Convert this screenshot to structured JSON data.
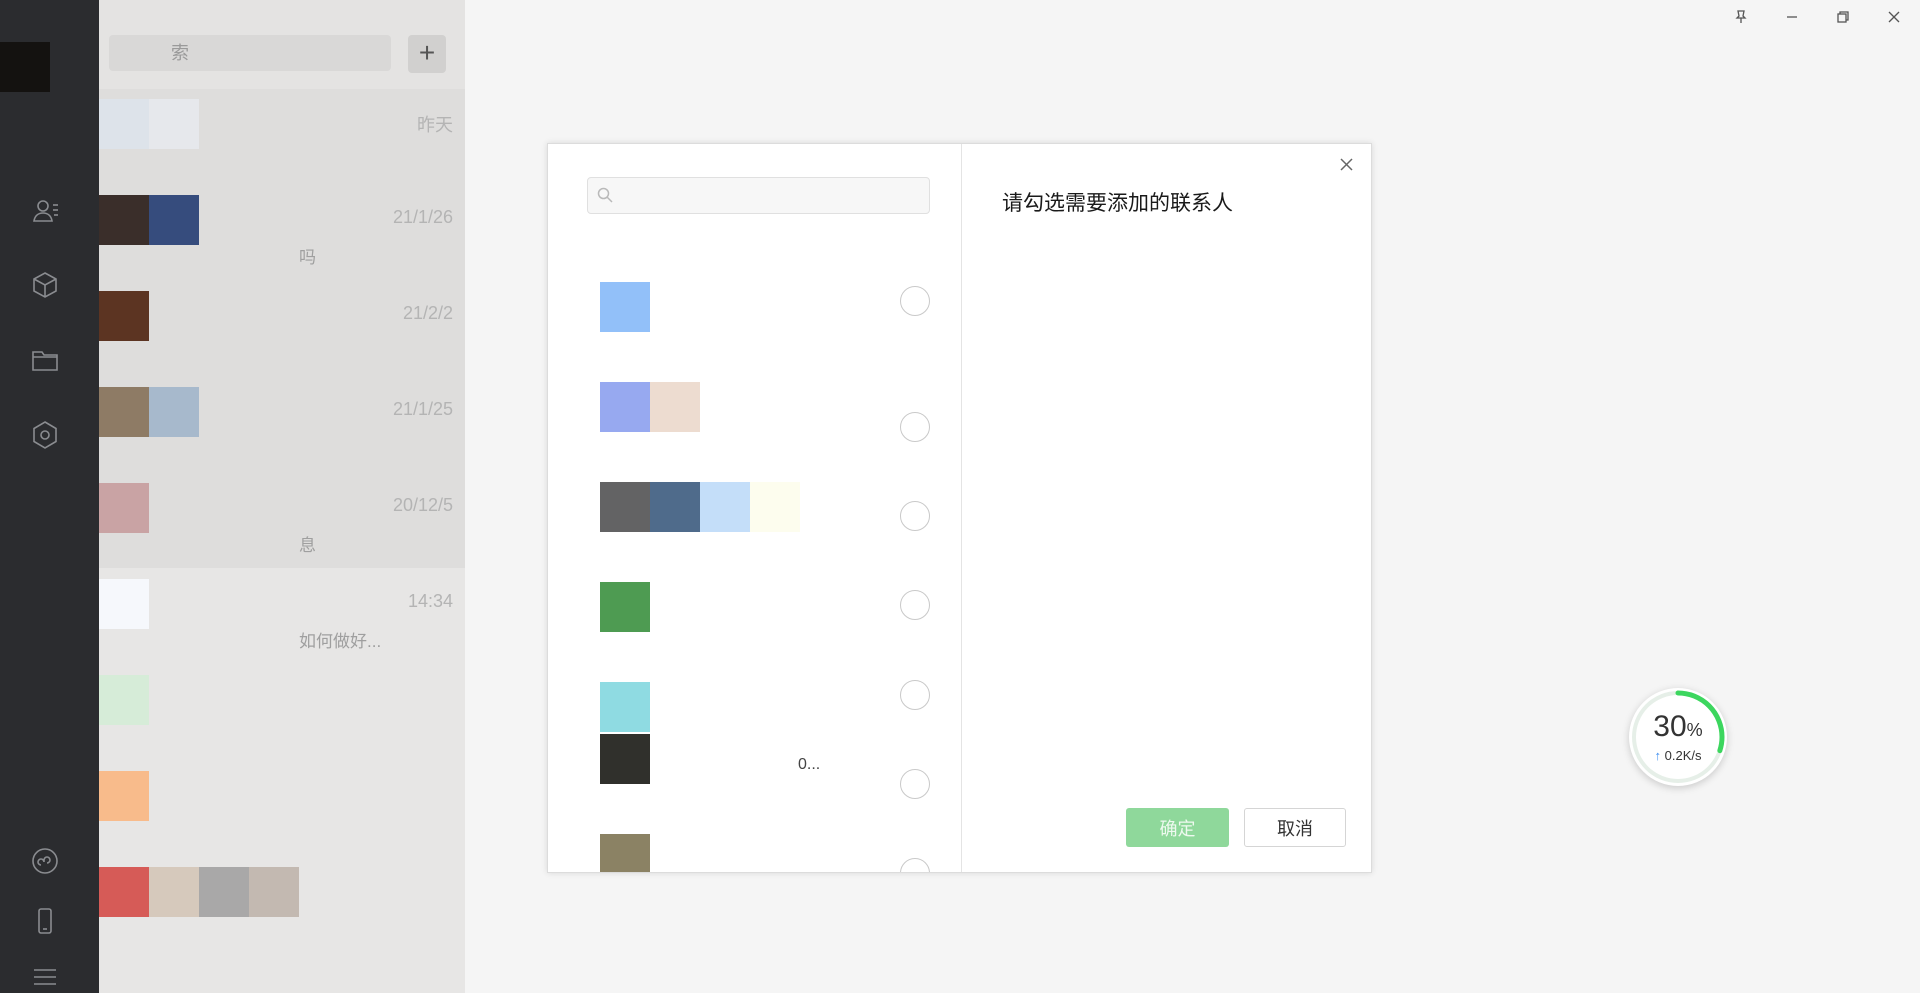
{
  "sidebar": {
    "icons": [
      "contacts-icon",
      "cube-icon",
      "folder-icon",
      "settings-hex-icon",
      "mini-program-icon",
      "phone-icon",
      "menu-icon"
    ]
  },
  "chatlist": {
    "search_placeholder": "索",
    "add_label": "+",
    "items": [
      {
        "time": "昨天",
        "preview": "",
        "tiles": [
          "#dde3ea",
          "#e6e8ec"
        ]
      },
      {
        "time": "21/1/26",
        "preview": "吗",
        "tiles": [
          "#3a2e2a",
          "#364c7d"
        ]
      },
      {
        "time": "21/2/2",
        "preview": "",
        "tiles": [
          "#5c3422"
        ]
      },
      {
        "time": "21/1/25",
        "preview": "",
        "tiles": [
          "#8e7b65",
          "#a7b9cc"
        ]
      },
      {
        "time": "20/12/5",
        "preview": "息",
        "tiles": [
          "#c9a3a4"
        ]
      },
      {
        "time": "14:34",
        "preview": "如何做好...",
        "tiles": [
          "#f6f8fc"
        ]
      },
      {
        "time": "",
        "preview": "",
        "tiles": [
          "#d6ecd8"
        ]
      },
      {
        "time": "",
        "preview": "",
        "tiles": [
          "#f8bb8b"
        ]
      },
      {
        "time": "",
        "preview": "",
        "tiles": [
          "#d65b57",
          "#d6c9bc",
          "#a9a8a8",
          "#c3b9b1"
        ]
      }
    ]
  },
  "window": {
    "buttons": [
      "pin-icon",
      "minimize-icon",
      "restore-icon",
      "close-icon"
    ]
  },
  "dialog": {
    "title": "请勾选需要添加的联系人",
    "ok_label": "确定",
    "cancel_label": "取消",
    "contacts": [
      {
        "name": "",
        "tiles": [
          "#92c0f9"
        ]
      },
      {
        "name": "",
        "tiles": [
          "#97a9f0",
          "#eddcd0"
        ]
      },
      {
        "name": "",
        "tiles": [
          "#636364",
          "#4f6b8b",
          "#c4def9",
          "#fdfdee"
        ]
      },
      {
        "name": "",
        "tiles": [
          "#4e9b52"
        ]
      },
      {
        "name": "",
        "tiles": [
          "#8fdbe2"
        ]
      },
      {
        "name": "0...",
        "tiles": [
          "#30302c"
        ]
      },
      {
        "name": "",
        "tiles": [
          "#8b8264"
        ]
      }
    ]
  },
  "network": {
    "percent": "30",
    "percent_sign": "%",
    "speed": "0.2K/s",
    "progress": 0.3,
    "ring_color": "#3cd65e"
  }
}
